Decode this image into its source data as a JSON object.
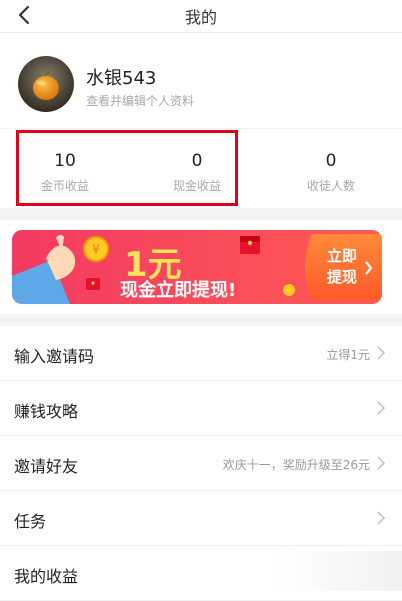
{
  "header": {
    "title": "我的",
    "back_icon": "back-arrow-icon"
  },
  "profile": {
    "name": "水银543",
    "subtitle": "查看并编辑个人资料",
    "avatar_icon": "orange-fruit-avatar"
  },
  "stats": [
    {
      "value": "10",
      "label": "金币收益"
    },
    {
      "value": "0",
      "label": "现金收益"
    },
    {
      "value": "0",
      "label": "收徒人数"
    }
  ],
  "banner": {
    "amount": "1元",
    "text": "现金立即提现!",
    "button_line1": "立即",
    "button_line2": "提现",
    "colors": {
      "start": "#f33a63",
      "end": "#ff6a4a",
      "accent": "#ffe25a"
    }
  },
  "menu": [
    {
      "label": "输入邀请码",
      "hint": "立得1元"
    },
    {
      "label": "赚钱攻略",
      "hint": ""
    },
    {
      "label": "邀请好友",
      "hint": "欢庆十一，奖励升级至26元"
    },
    {
      "label": "任务",
      "hint": ""
    },
    {
      "label": "我的收益",
      "hint": ""
    }
  ],
  "colors": {
    "highlight_box": "#e0001a"
  }
}
